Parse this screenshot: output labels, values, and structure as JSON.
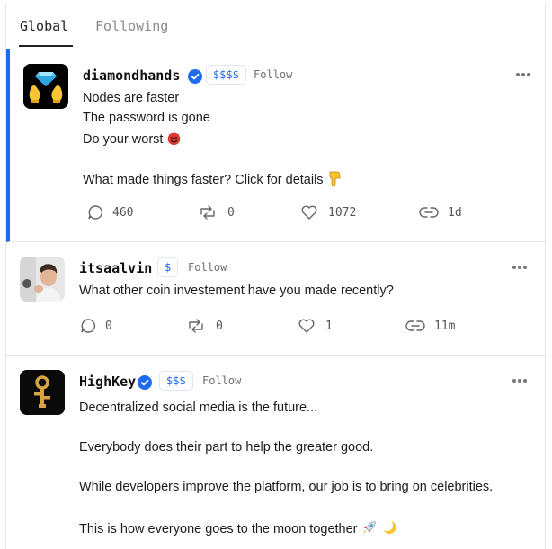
{
  "tabs": [
    {
      "label": "Global",
      "active": true
    },
    {
      "label": "Following",
      "active": false
    }
  ],
  "posts": [
    {
      "username": "diamondhands",
      "verified": true,
      "badge": "$$$$",
      "follow_label": "Follow",
      "lines": [
        "Nodes are faster",
        "The password is gone",
        "Do your worst",
        "",
        "What made things faster? Click for details"
      ],
      "emoji": [
        "smiling-devil-emoji",
        "pointing-down-hand-emoji"
      ],
      "stats": {
        "comments": "460",
        "reposts": "0",
        "likes": "1072",
        "time": "1d"
      }
    },
    {
      "username": "itsaalvin",
      "verified": false,
      "badge": "$",
      "follow_label": "Follow",
      "lines": [
        "What other coin investement have you made recently?"
      ],
      "stats": {
        "comments": "0",
        "reposts": "0",
        "likes": "1",
        "time": "11m"
      }
    },
    {
      "username": "HighKey",
      "verified": true,
      "badge": "$$$",
      "follow_label": "Follow",
      "lines": [
        "Decentralized social media is the future...",
        "",
        "Everybody does their part to help the greater good.",
        "",
        "While developers improve the platform, our job is to bring on celebrities.",
        "",
        "This is how everyone goes to the moon together"
      ],
      "emoji": [
        "rocket-emoji",
        "crescent-moon-emoji"
      ]
    }
  ],
  "colors": {
    "accent": "#1f6bf0",
    "divider": "#e6e6e6",
    "devil": "#d83a2e"
  }
}
